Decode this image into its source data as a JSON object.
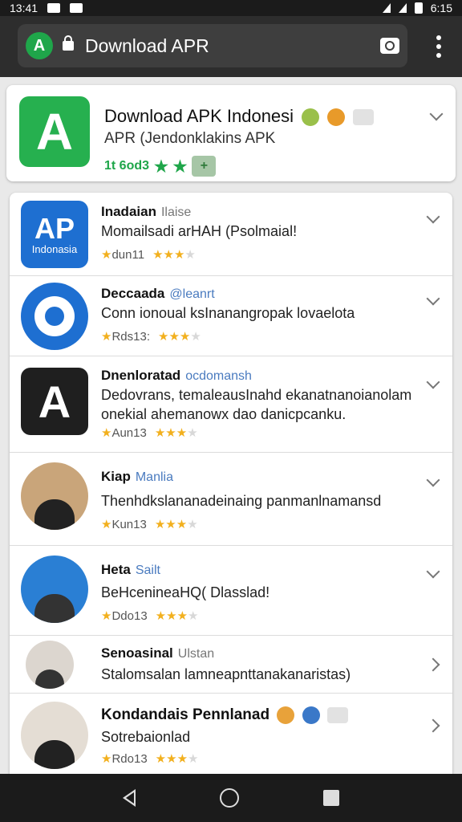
{
  "status_bar": {
    "time_left": "13:41",
    "time_right": "6:15"
  },
  "browser": {
    "url_title": "Download APR"
  },
  "top_card": {
    "title": "Download APK Indonesi",
    "subtitle": "APR (Jendonklakins APK",
    "rating_text": "1t 6od3",
    "stars": "★ ★"
  },
  "items": [
    {
      "name": "Inadaian",
      "tag": "Ilaise",
      "desc": "Momailsadi arHAH (Psolmaial!",
      "meta_label": "dun11",
      "stars_full": 2,
      "logo_text": "AP",
      "logo_sub": "Indonasia"
    },
    {
      "name": "Deccaada",
      "tag": "@leanrt",
      "desc": "Conn ionoual ksInanangropak lovaelota",
      "meta_label": "Rds13:",
      "stars_full": 2
    },
    {
      "name": "Dnenloratad",
      "tag": "ocdomansh",
      "desc": "Dedovrans, temaleausInahd ekanatnanoianolam onekial ahemanowx dao danicpcanku.",
      "meta_label": "Aun13",
      "stars_full": 2
    },
    {
      "name": "Kiap",
      "tag": "Manlia",
      "desc": "Thenhdkslananadeinaing panmanlnamansd",
      "meta_label": "Kun13",
      "stars_full": 2
    },
    {
      "name": "Heta",
      "tag": "Sailt",
      "desc": "BeHcenineaHQ( Dlasslad!",
      "meta_label": "Ddo13",
      "stars_full": 2
    },
    {
      "name": "Senoasinal",
      "tag": "Ulstan",
      "desc": "Stalomsalan lamneapnttanakanaristas)",
      "meta_label": "",
      "stars_full": 0
    },
    {
      "name": "Kondandais Pennlanad",
      "tag": "",
      "desc": "Sotrebaionlad",
      "meta_label": "Rdo13",
      "stars_full": 2
    }
  ],
  "colors": {
    "accent_green": "#26b04f",
    "star": "#f2b01e",
    "link_blue": "#4a7bbf"
  }
}
